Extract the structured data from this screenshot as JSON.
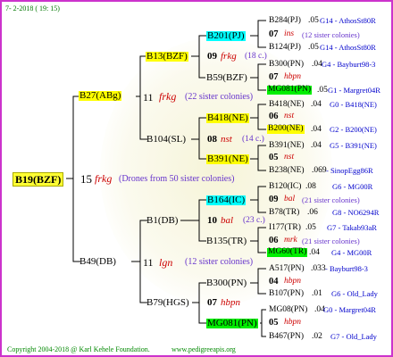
{
  "header": {
    "date": "7-  2-2018 ( 19: 15)"
  },
  "footer": {
    "copyright": "Copyright 2004-2018 @ Karl Kehele Foundation.",
    "site": "www.pedigreeapis.org"
  },
  "root": {
    "name": "B19(BZF)",
    "gen": "15",
    "code": "frkg",
    "info": "(Drones from 50 sister colonies)"
  },
  "g1": {
    "sire": {
      "name": "B27(ABg)",
      "gen": "11",
      "code": "frkg",
      "info": "(22 sister colonies)"
    },
    "dam": {
      "name": "B49(DB)",
      "gen": "11",
      "code": "lgn",
      "info": "(12 sister colonies)"
    }
  },
  "g2": {
    "a": {
      "name": "B13(BZF)",
      "gen": "09",
      "code": "frkg",
      "info": "(18 c.)"
    },
    "b": {
      "name": "B104(SL)",
      "gen": "08",
      "code": "nst",
      "info": "(14 c.)"
    },
    "c": {
      "name": "B1(DB)",
      "gen": "10",
      "code": "bal",
      "info": "(23 c.)"
    },
    "d": {
      "name": "B79(HGS)",
      "gen": "07",
      "code": "hbpn",
      "info": ""
    }
  },
  "g3": {
    "a": {
      "name": "B201(PJ)"
    },
    "b": {
      "name": "B59(BZF)",
      "gen": "07",
      "code": "hbpn"
    },
    "c": {
      "name": "B418(NE)",
      "gen": "06",
      "code": "nst"
    },
    "d": {
      "name": "B391(NE)",
      "gen": "05",
      "code": "nst"
    },
    "e": {
      "name": "B164(IC)",
      "gen": "09",
      "code": "bal",
      "info": "(21 sister colonies)"
    },
    "f": {
      "name": "B135(TR)",
      "gen": "06",
      "code": "mrk",
      "info": "(21 sister colonies)"
    },
    "g": {
      "name": "B300(PN)",
      "gen": "04",
      "code": "hbpn"
    },
    "h": {
      "name": "MG081(PN)",
      "gen": "05",
      "code": "hbpn"
    }
  },
  "g4": {
    "a1": {
      "name": "B284(PJ)",
      "val": ".05",
      "place": "G14 - AthosSt80R"
    },
    "a_gen": "07",
    "a_code": "ins",
    "a_info": "(12 sister colonies)",
    "a2": {
      "name": "B124(PJ)",
      "val": ".05",
      "place": "G14 - AthosSt80R"
    },
    "b1": {
      "name": "B300(PN)",
      "val": ".04",
      "place": "G4 - Bayburt98-3"
    },
    "b2": {
      "name": "MG081(PN)",
      "val": ".05",
      "place": "G1 - Margret04R"
    },
    "c1": {
      "name": "B418(NE)",
      "val": ".04",
      "place": "G0 - B418(NE)"
    },
    "c2": {
      "name": "B200(NE)",
      "val": ".04",
      "place": "G2 - B200(NE)"
    },
    "d1": {
      "name": "B391(NE)",
      "val": ".04",
      "place": "G5 - B391(NE)"
    },
    "d2": {
      "name": "B238(NE)",
      "val": ".069",
      "place": "- SinopEgg86R"
    },
    "e1": {
      "name": "B120(IC)",
      "val": ".08",
      "place": "G6 - MG00R"
    },
    "e2": {
      "name": "B78(TR)",
      "val": ".06",
      "place": "G8 - NO6294R"
    },
    "f1": {
      "name": "I177(TR)",
      "val": ".05",
      "place": "G7 - Takab93aR"
    },
    "f2": {
      "name": "MG60(TR)",
      "val": ".04",
      "place": "G4 - MG00R"
    },
    "g1": {
      "name": "A517(PN)",
      "val": ".033",
      "place": "- Bayburt98-3"
    },
    "g2": {
      "name": "B107(PN)",
      "val": ".01",
      "place": "G6 - Old_Lady"
    },
    "h1": {
      "name": "MG08(PN)",
      "val": ".04",
      "place": "G0 - Margret04R"
    },
    "h2": {
      "name": "B467(PN)",
      "val": ".02",
      "place": "G7 - Old_Lady"
    }
  }
}
